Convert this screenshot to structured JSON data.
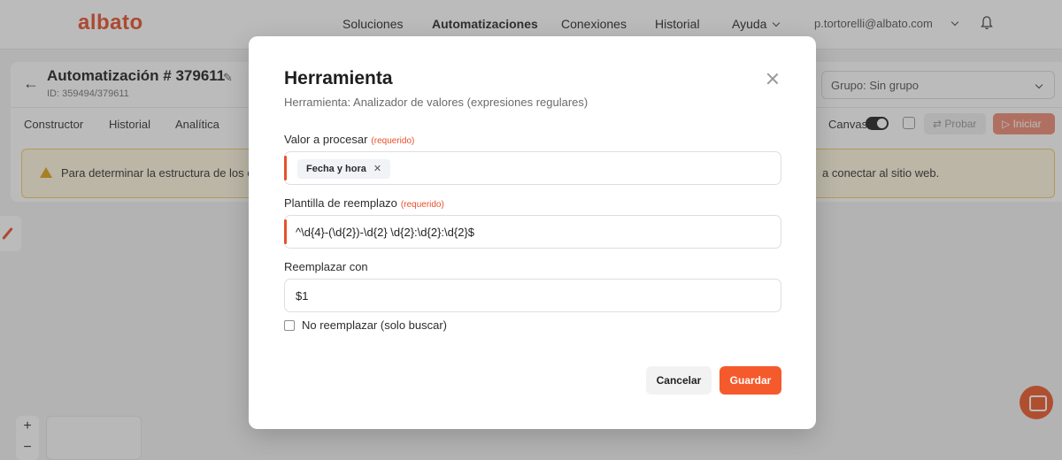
{
  "brand": {
    "logo": "albato",
    "accent": "#f45a2b"
  },
  "nav": {
    "items": [
      "Soluciones",
      "Automatizaciones",
      "Conexiones",
      "Historial",
      "Ayuda"
    ],
    "active": "Automatizaciones",
    "user_email": "p.tortorelli@albato.com"
  },
  "automation": {
    "title": "Automatización # 379611",
    "id_text": "ID: 359494/379611",
    "group": "Grupo: Sin grupo",
    "tabs": [
      "Constructor",
      "Historial",
      "Analítica"
    ],
    "canvas_label": "Canvas",
    "probar": "Probar",
    "iniciar": "Iniciar",
    "warning_left": "Para determinar la estructura de los c",
    "warning_right": "a conectar al sitio web."
  },
  "modal": {
    "title": "Herramienta",
    "subtitle": "Herramienta: Analizador de valores (expresiones regulares)",
    "fields": [
      {
        "label": "Valor a procesar",
        "required": "(requerido)",
        "chip": "Fecha y hora"
      },
      {
        "label": "Plantilla de reemplazo",
        "required": "(requerido)",
        "value": "^\\d{4}-(\\d{2})-\\d{2} \\d{2}:\\d{2}:\\d{2}$"
      },
      {
        "label": "Reemplazar con",
        "value": "$1"
      }
    ],
    "checkbox_label": "No reemplazar (solo buscar)",
    "cancel": "Cancelar",
    "save": "Guardar"
  }
}
